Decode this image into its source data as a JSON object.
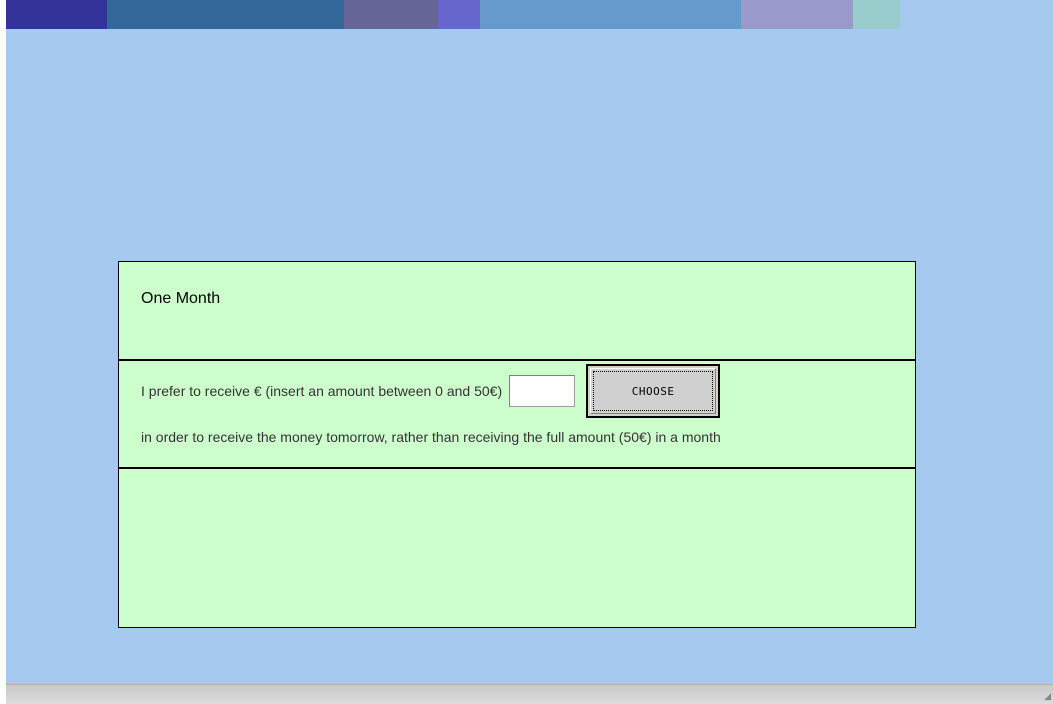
{
  "header_strip": {
    "colors": [
      "#333399",
      "#336699",
      "#666699",
      "#6666cc",
      "#6699cc",
      "#9999cc",
      "#99cccc",
      "#a6c9ef"
    ]
  },
  "panel": {
    "title": "One Month",
    "prompt": "I prefer to receive € (insert an amount between 0 and 50€)",
    "amount_value": "",
    "amount_placeholder": "",
    "choose_label": "CHOOSE",
    "explanation": "in order to receive the money tomorrow, rather than receiving the full amount (50€) in a month"
  },
  "colors": {
    "background": "#a6c9ef",
    "panel": "#ccffcc",
    "border": "#000000"
  },
  "statusbar": {
    "grip_icon": "resize-grip-icon"
  }
}
